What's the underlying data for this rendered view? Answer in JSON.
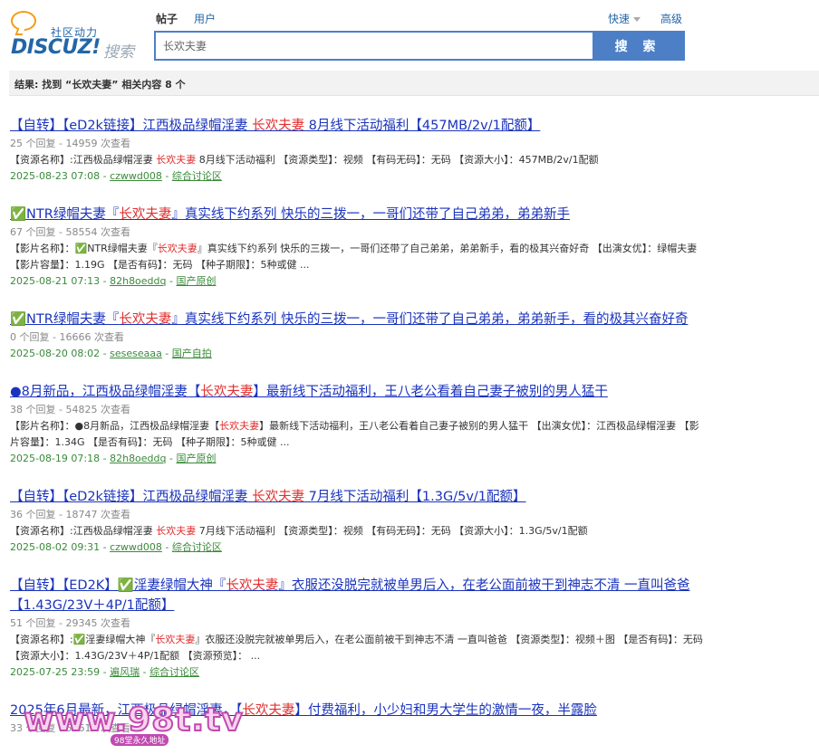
{
  "logo": {
    "slogan": "社区动力",
    "brand": "DISCUZ",
    "brand_mark": "!",
    "search_word": "搜索"
  },
  "tabs": [
    {
      "label": "帖子",
      "active": true
    },
    {
      "label": "用户",
      "active": false
    }
  ],
  "advanced": {
    "quick": "快速",
    "advanced": "高级"
  },
  "search": {
    "value": "长欢夫妻",
    "button": "搜 索"
  },
  "result_summary": "结果: 找到 “长欢夫妻” 相关内容 8 个",
  "results": [
    {
      "title_a": "【自转】【eD2k链接】江西极品绿帽淫妻 ",
      "title_kw": "长欢夫妻",
      "title_b": " 8月线下活动福利【457MB/2v/1配额】",
      "meta": "25 个回复 - 14959 次查看",
      "desc_a": "【资源名称】:江西极品绿帽淫妻 ",
      "desc_kw": "长欢夫妻",
      "desc_b": " 8月线下活动福利 【资源类型】：视频 【有码无码】：无码 【资源大小】：457MB/2v/1配额",
      "date": "2025-08-23 07:08",
      "author": "czwwd008",
      "forum": "综合讨论区"
    },
    {
      "title_a": "✅NTR绿帽夫妻『",
      "title_kw": "长欢夫妻",
      "title_b": "』真实线下约系列 快乐的三拨一，一哥们还带了自己弟弟，弟弟新手",
      "meta": "67 个回复 - 58554 次查看",
      "desc_a": "【影片名称】：✅NTR绿帽夫妻『",
      "desc_kw": "长欢夫妻",
      "desc_b": "』真实线下约系列 快乐的三拨一，一哥们还带了自己弟弟，弟弟新手，看的极其兴奋好奇 【出演女优】：绿帽夫妻 【影片容量】：1.19G 【是否有码】：无码 【种子期限】：5种或健 ...",
      "date": "2025-08-21 07:13",
      "author": "82h8oeddq",
      "forum": "国产原创"
    },
    {
      "title_a": "✅NTR绿帽夫妻『",
      "title_kw": "长欢夫妻",
      "title_b": "』真实线下约系列 快乐的三拨一，一哥们还带了自己弟弟，弟弟新手，看的极其兴奋好奇",
      "meta": "0 个回复 - 16666 次查看",
      "desc_a": "",
      "desc_kw": "",
      "desc_b": "",
      "date": "2025-08-20 08:02",
      "author": "seseseaaa",
      "forum": "国产自拍"
    },
    {
      "title_a": "●8月新品，江西极品绿帽淫妻【",
      "title_kw": "长欢夫妻",
      "title_b": "】最新线下活动福利，王八老公看着自己妻子被别的男人猛干",
      "meta": "38 个回复 - 54825 次查看",
      "desc_a": "【影片名称】：●8月新品，江西极品绿帽淫妻【",
      "desc_kw": "长欢夫妻",
      "desc_b": "】最新线下活动福利，王八老公看着自己妻子被别的男人猛干 【出演女优】：江西极品绿帽淫妻 【影片容量】：1.34G 【是否有码】：无码 【种子期限】：5种或健 ...",
      "date": "2025-08-19 07:18",
      "author": "82h8oeddq",
      "forum": "国产原创"
    },
    {
      "title_a": "【自转】【eD2k链接】江西极品绿帽淫妻 ",
      "title_kw": "长欢夫妻",
      "title_b": " 7月线下活动福利【1.3G/5v/1配额】",
      "meta": "36 个回复 - 18747 次查看",
      "desc_a": "【资源名称】:江西极品绿帽淫妻 ",
      "desc_kw": "长欢夫妻",
      "desc_b": " 7月线下活动福利 【资源类型】：视频 【有码无码】：无码 【资源大小】：1.3G/5v/1配额",
      "date": "2025-08-02 09:31",
      "author": "czwwd008",
      "forum": "综合讨论区"
    },
    {
      "title_a": "【自转】【ED2K】✅淫妻绿帽大神『",
      "title_kw": "长欢夫妻",
      "title_b": "』衣服还没脱完就被单男后入，在老公面前被干到神志不清 一直叫爸爸【1.43G/23V＋4P/1配额】",
      "meta": "51 个回复 - 29345 次查看",
      "desc_a": "【资源名称】:✅淫妻绿帽大神『",
      "desc_kw": "长欢夫妻",
      "desc_b": "』衣服还没脱完就被单男后入，在老公面前被干到神志不清 一直叫爸爸 【资源类型】：视频＋图 【是否有码】：无码 【资源大小】：1.43G/23V＋4P/1配额 【资源预览】： ...",
      "date": "2025-07-25 23:59",
      "author": "遍风瑞",
      "forum": "综合讨论区"
    },
    {
      "title_a": "2025年6月最新，江西极品绿帽淫妻，【",
      "title_kw": "长欢夫妻",
      "title_b": "】付费福利，小少妇和男大学生的激情一夜，半露脸",
      "meta": "33 个回复 - 50618 次查看",
      "desc_a": "",
      "desc_kw": "",
      "desc_b": "",
      "date": "",
      "author": "",
      "forum": ""
    }
  ],
  "watermark": {
    "main": "www.98t.tv",
    "sub": "98堂永久地址"
  }
}
